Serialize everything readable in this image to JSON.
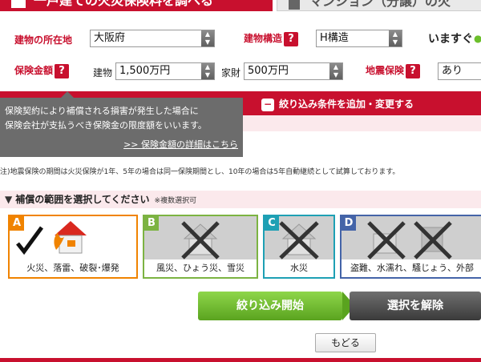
{
  "tabs": {
    "active_label": "一戸建ての火災保険料を調べる",
    "inactive_label": "マンション（分譲）の火"
  },
  "conditions": {
    "location_label": "建物の所在地",
    "location_value": "大阪府",
    "structure_label": "建物構造",
    "structure_help": "?",
    "structure_value": "H構造",
    "now_text": "いますぐ",
    "amount_label": "保険金額",
    "amount_help": "?",
    "building_label": "建物",
    "building_value": "1,500万円",
    "household_label": "家財",
    "household_value": "500万円",
    "earthquake_label": "地震保険",
    "earthquake_help": "?",
    "earthquake_value": "あり"
  },
  "filter_bar": {
    "toggle_label": "絞り込み条件を追加・変更する"
  },
  "tooltip": {
    "line1": "保険契約により補償される損害が発生した場合に",
    "line2": "保険会社が支払うべき保険金の限度額をいいます。",
    "link": ">> 保険金額の詳細はこちら"
  },
  "note": "注)地震保険の期間は火災保険が1年、5年の場合は同一保険期間とし、10年の場合は5年自動継続として試算しております。",
  "coverage": {
    "title": "補償の範囲を選択してください",
    "subtitle": "※複数選択可",
    "cards": [
      {
        "letter": "A",
        "label": "火災、落雷、破裂･爆発",
        "selected": true,
        "color": "#f08300"
      },
      {
        "letter": "B",
        "label": "風災、ひょう災、雪災",
        "selected": false,
        "color": "#7cb342"
      },
      {
        "letter": "C",
        "label": "水災",
        "selected": false,
        "color": "#1ea0b4"
      },
      {
        "letter": "D",
        "label": "盗難、水濡れ、騒じょう、外部",
        "selected": false,
        "color": "#4464a8"
      }
    ]
  },
  "actions": {
    "start_label": "絞り込み開始",
    "clear_label": "選択を解除",
    "back_label": "もどる"
  },
  "colors": {
    "brand_red": "#c8102e",
    "green": "#6cbf2c",
    "dark_gray": "#4a4a4a"
  }
}
